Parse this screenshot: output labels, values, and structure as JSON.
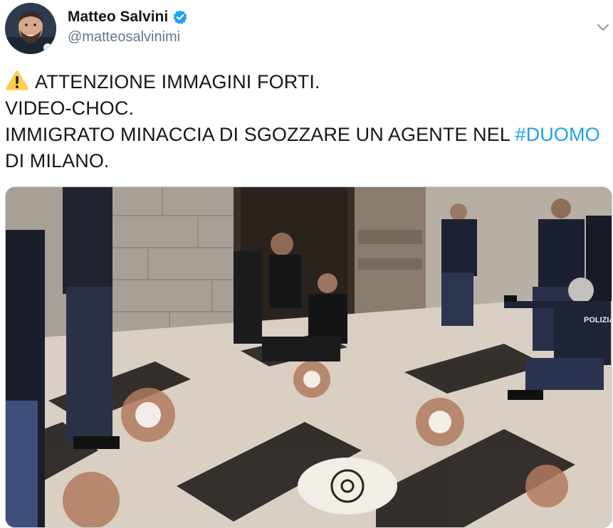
{
  "tweet": {
    "author": {
      "display_name": "Matteo Salvini",
      "handle": "@matteosalvinimi",
      "verified": true
    },
    "text_lines": [
      "ATTENZIONE IMMAGINI FORTI.",
      "VIDEO-CHOC.",
      "IMMIGRATO MINACCIA DI SGOZZARE UN AGENTE NEL ",
      "DI MILANO."
    ],
    "hashtag": "#DUOMO",
    "warning_icon": "warning-sign-emoji",
    "media": {
      "type": "video-thumbnail",
      "uniform_text": "POLIZIA"
    }
  },
  "colors": {
    "link": "#1da1f2",
    "handle": "#657786",
    "verified": "#1da1f2",
    "text": "#14171a"
  }
}
